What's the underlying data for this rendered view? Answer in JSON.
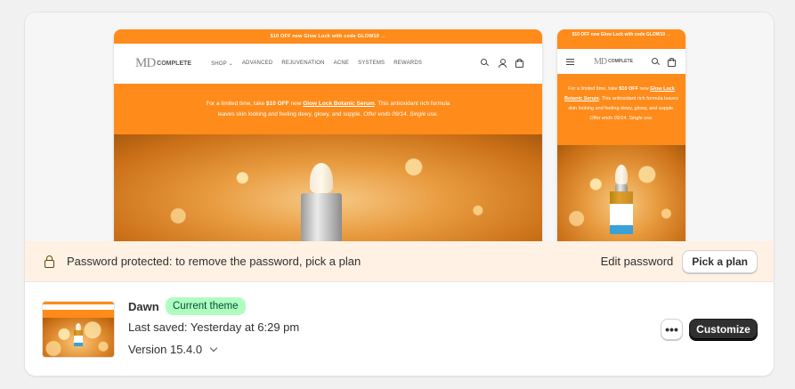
{
  "preview": {
    "desktop": {
      "announcement": "$10 OFF new Glow Lock with code GLOW10 →",
      "logo_mark": "MD",
      "logo_word": "COMPLETE",
      "menu": [
        "SHOP ⌄",
        "ADVANCED",
        "REJUVENATION",
        "ACNE",
        "SYSTEMS",
        "REWARDS"
      ],
      "promo": {
        "pre": "For a limited time, take ",
        "bold": "$10 OFF",
        "mid": " new ",
        "link": "Glow Lock Botanic Serum",
        "post": ". This antioxidant rich formula",
        "line2": "leaves skin looking and feeling dewy, glowy, and supple. ",
        "italic": "Offer ends 09/14. Single use."
      }
    },
    "mobile": {
      "announcement": "$10 OFF new Glow Lock with code GLOW10 →",
      "logo_mark": "MD",
      "logo_word": "COMPLETE",
      "promo": {
        "pre": "For a limited time, take ",
        "bold": "$10 OFF",
        "mid": " new ",
        "link": "Glow Lock Botanic Serum",
        "post": ". This antioxidant rich formula leaves skin looking and feeling dewy, glowy, and supple. ",
        "italic": "Offer ends 09/14. Single use."
      }
    }
  },
  "banner": {
    "message": "Password protected: to remove the password, pick a plan",
    "edit_password": "Edit password",
    "pick_plan": "Pick a plan"
  },
  "theme": {
    "name": "Dawn",
    "badge": "Current theme",
    "last_saved": "Last saved: Yesterday at 6:29 pm",
    "version": "Version 15.4.0",
    "more_label": "•••",
    "customize": "Customize"
  },
  "colors": {
    "brand_orange": "#ff8b1a",
    "badge_bg": "#affebf",
    "banner_bg": "#fff1e3",
    "primary_button": "#303030"
  },
  "icons": [
    "search-icon",
    "account-icon",
    "cart-icon",
    "menu-icon",
    "lock-icon",
    "chevron-down-icon"
  ]
}
